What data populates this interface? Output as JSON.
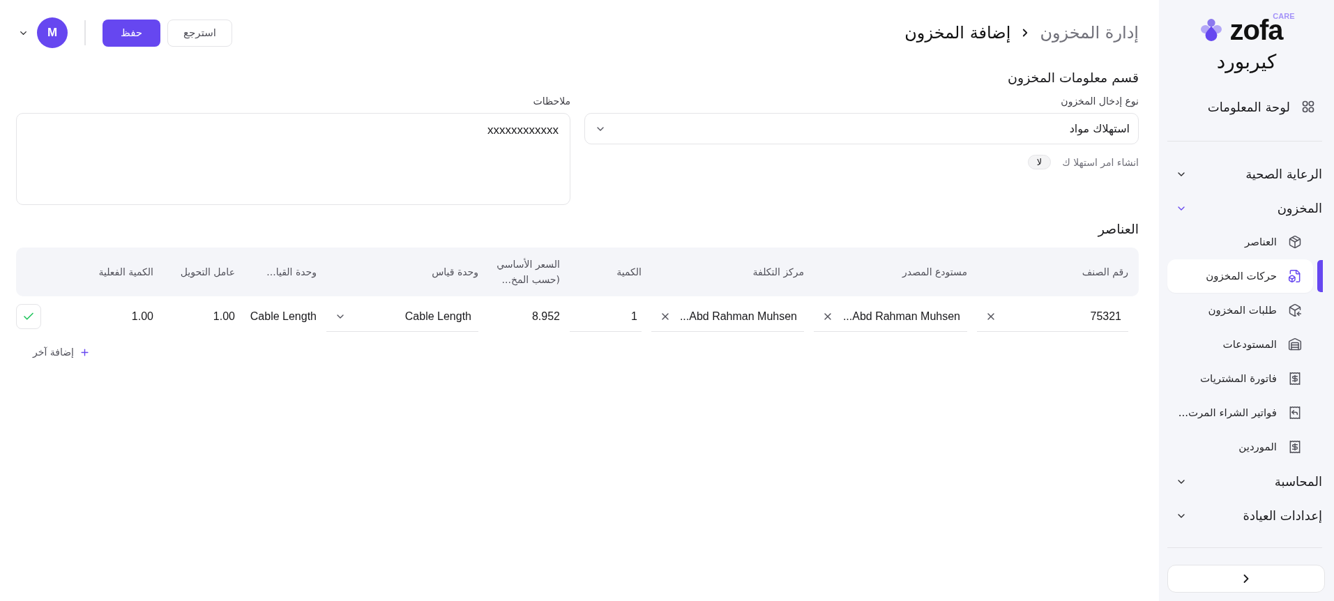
{
  "sidebar": {
    "logo": {
      "wordmark": "zofa",
      "tag": "CARE"
    },
    "app_name": "كيربورد",
    "dashboard": {
      "label": "لوحة المعلومات"
    },
    "sections": [
      {
        "label": "الرعاية الصحية",
        "expanded": false
      },
      {
        "label": "المخزون",
        "expanded": true,
        "children": [
          {
            "label": "العناصر",
            "selected": false
          },
          {
            "label": "حركات المخزون",
            "selected": true
          },
          {
            "label": "طلبات المخزون",
            "selected": false
          },
          {
            "label": "المستودعات",
            "selected": false
          },
          {
            "label": "فاتورة المشتريات",
            "selected": false
          },
          {
            "label": "فواتير الشراء المرت...",
            "selected": false
          },
          {
            "label": "الموردين",
            "selected": false
          }
        ]
      },
      {
        "label": "المحاسبة",
        "expanded": false
      },
      {
        "label": "إعدادات العيادة",
        "expanded": false
      }
    ]
  },
  "header": {
    "breadcrumb": [
      {
        "label": "إدارة المخزون",
        "current": false
      },
      {
        "label": "إضافة المخزون",
        "current": true
      }
    ],
    "actions": [
      {
        "label": "استرجع",
        "kind": "secondary"
      },
      {
        "label": "حفظ",
        "kind": "primary"
      }
    ],
    "user": {
      "initial": "M"
    }
  },
  "form": {
    "title": "قسم معلومات المخزون",
    "entry_type": {
      "label": "نوع إدخال المخزون",
      "value": "استهلاك مواد"
    },
    "consumption_order": {
      "label": "انشاء امر استهلا ك",
      "value": "لا"
    },
    "notes": {
      "label": "ملاحظات",
      "value": "xxxxxxxxxxxx"
    }
  },
  "items": {
    "title": "العناصر",
    "columns": [
      "رقم الصنف",
      "مستودع المصدر",
      "مركز التكلفة",
      "الكمية",
      "السعر الأساسي (حسب المخ...",
      "وحدة قياس",
      "وحدة القيا...",
      "عامل التحويل",
      "الكمية الفعلية"
    ],
    "rows": [
      {
        "cells": [
          {
            "kind": "clearable",
            "value": "75321"
          },
          {
            "kind": "clearable",
            "value": "Abd Rahman Muhsen..."
          },
          {
            "kind": "clearable",
            "value": "Abd Rahman Muhsen..."
          },
          {
            "kind": "input",
            "value": "1"
          },
          {
            "kind": "text",
            "value": "8.952"
          },
          {
            "kind": "select",
            "value": "Cable Length"
          },
          {
            "kind": "text",
            "value": "Cable Length"
          },
          {
            "kind": "text",
            "value": "1.00"
          },
          {
            "kind": "text",
            "value": "1.00"
          }
        ]
      }
    ],
    "add_button": "إضافة آخر"
  }
}
